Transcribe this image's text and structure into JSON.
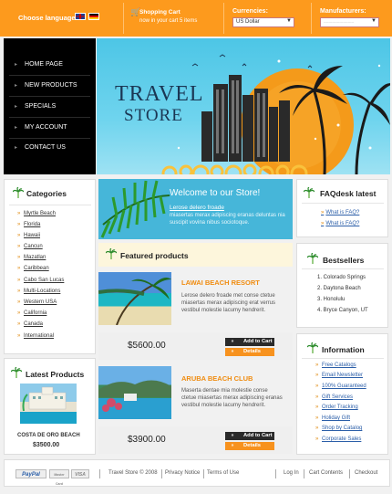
{
  "header": {
    "choose_language": "Choose language:",
    "cart_title": "Shopping Cart",
    "cart_sub": "now in your cart  5 items",
    "currencies_label": "Currencies:",
    "currency_value": "US Dollar",
    "manufacturers_label": "Manufacturers:",
    "manufacturers_value": "-------------------------"
  },
  "nav": {
    "items": [
      "HOME PAGE",
      "NEW PRODUCTS",
      "SPECIALS",
      "MY ACCOUNT",
      "CONTACT US"
    ]
  },
  "banner": {
    "line1": "TRAVEL",
    "line2": "STORE"
  },
  "categories": {
    "title": "Categories",
    "items": [
      "Myrtle Beach",
      "Florida",
      "Hawaii",
      "Cancun",
      "Mazatlan",
      "Caribbean",
      "Cabo San Lucas",
      "Multi-Locations",
      "Western USA",
      "California",
      "Canada",
      "International"
    ]
  },
  "latest_products": {
    "title": "Latest Products",
    "item_name": "COSTA DE ORO BEACH",
    "item_price": "$3500.00"
  },
  "welcome": {
    "title": "Welcome to our Store!",
    "link": "Lerose delero froade",
    "body": "miasertas merax adipiscing eranas deluntas nia suscipit vovina nibus sociotoque."
  },
  "featured": {
    "title": "Featured products",
    "products": [
      {
        "name": "LAWAI BEACH RESORT",
        "desc": "Lerose delero froade met conse ctetue miasertas merax adipiscing erat verrus vestibul molestie lacumy hendrerit.",
        "price": "$5600.00",
        "add": "Add to Cart",
        "details": "Details"
      },
      {
        "name": "ARUBA BEACH CLUB",
        "desc": "Maserta dentae mia molestie conse ctetue miasertas merax adipiscing eranas vestibul molestie lacumy hendrerit.",
        "price": "$3900.00",
        "add": "Add to Cart",
        "details": "Details"
      }
    ]
  },
  "faq": {
    "title": "FAQdesk latest",
    "items": [
      "What is FAQ?",
      "What is FAQ?"
    ]
  },
  "bestsellers": {
    "title": "Bestsellers",
    "items": [
      "1.  Colorado Springs",
      "2.  Daytona Beach",
      "3.  Honolulu",
      "4.  Bryce Canyon, UT"
    ]
  },
  "information": {
    "title": "Information",
    "items": [
      "Free Catalogs",
      "Email Newsletter",
      "100% Guaranteed",
      "Gift Services",
      "Order Tracking",
      "Holiday Gift",
      "Shop by Catalog",
      "Corporate Sales"
    ]
  },
  "footer": {
    "paypal": "PayPal",
    "mastercard": "Master Card",
    "visa": "VISA",
    "copyright": "Travel Store © 2008",
    "privacy": "Privacy Notice",
    "terms": "Terms of Use",
    "login": "Log In",
    "cart": "Cart Contents",
    "checkout": "Checkout"
  },
  "colors": {
    "accent": "#fd9a1d",
    "sky": "#4dc6e6",
    "nav": "#000000"
  }
}
